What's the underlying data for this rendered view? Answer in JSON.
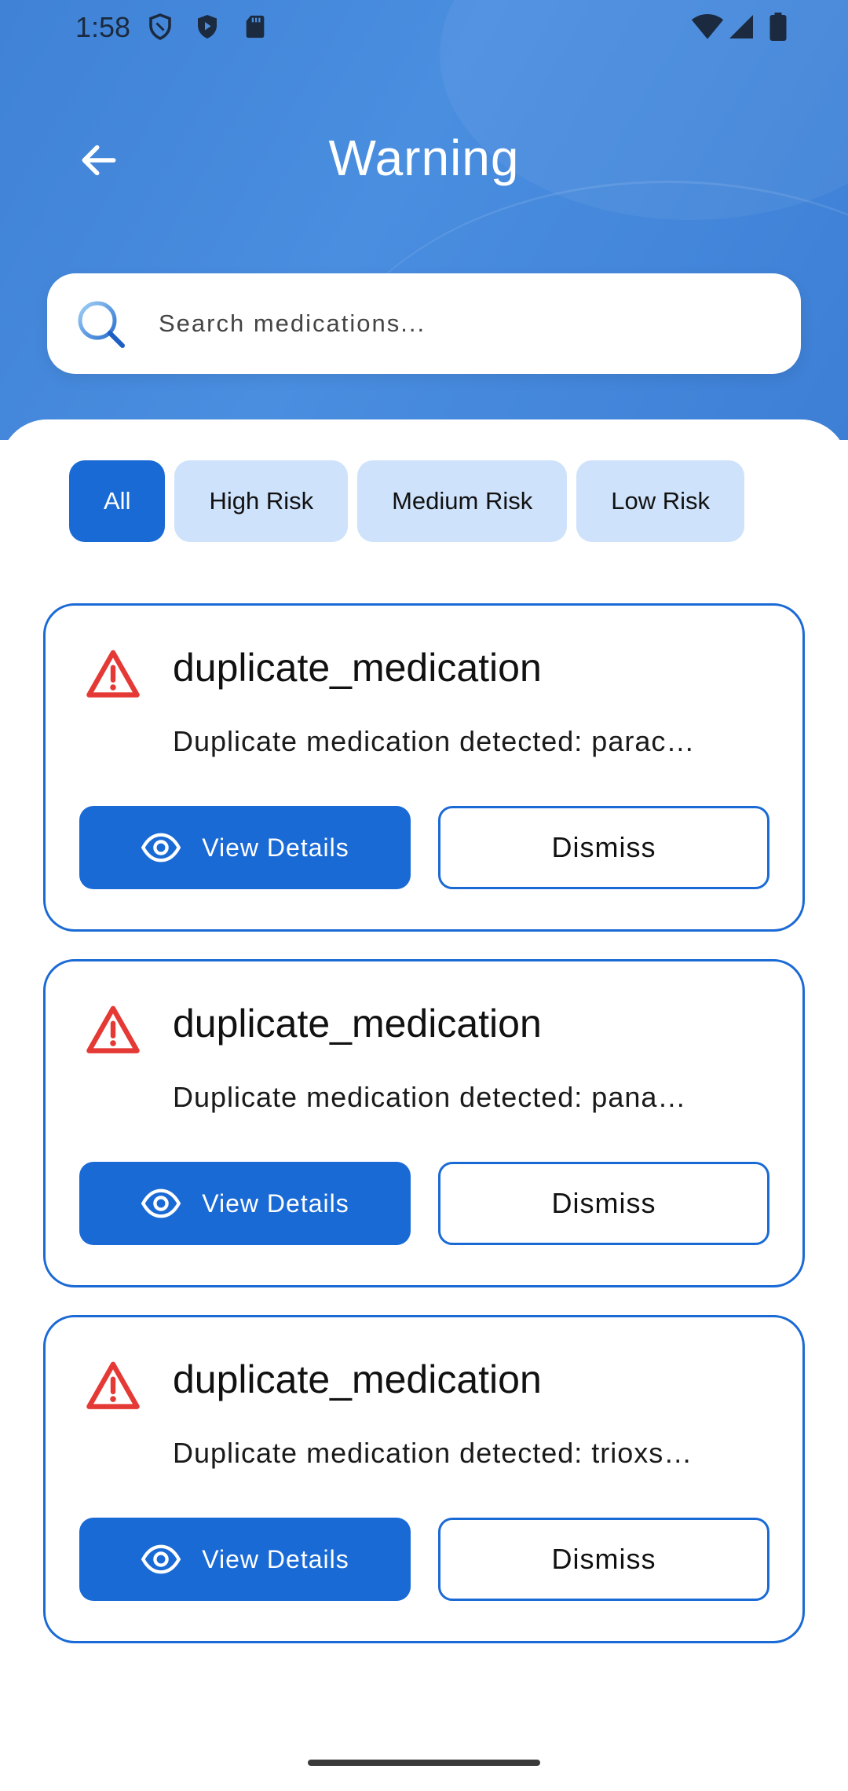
{
  "status_bar": {
    "time": "1:58",
    "left_icons": [
      "shield-icon",
      "play-shield-icon",
      "sd-card-icon"
    ],
    "right_icons": [
      "wifi-icon",
      "signal-icon",
      "battery-icon"
    ]
  },
  "header": {
    "title": "Warning",
    "back_icon": "arrow-left-icon"
  },
  "search": {
    "placeholder": "Search medications...",
    "value": ""
  },
  "filters": [
    {
      "label": "All",
      "active": true
    },
    {
      "label": "High Risk",
      "active": false
    },
    {
      "label": "Medium Risk",
      "active": false
    },
    {
      "label": "Low Risk",
      "active": false
    }
  ],
  "warnings": [
    {
      "title": "duplicate_medication",
      "description": "Duplicate medication detected: parac…",
      "view_label": "View Details",
      "dismiss_label": "Dismiss"
    },
    {
      "title": "duplicate_medication",
      "description": "Duplicate medication detected: pana…",
      "view_label": "View Details",
      "dismiss_label": "Dismiss"
    },
    {
      "title": "duplicate_medication",
      "description": "Duplicate medication detected: trioxs…",
      "view_label": "View Details",
      "dismiss_label": "Dismiss"
    }
  ],
  "colors": {
    "primary": "#1a6ad6",
    "chip_inactive": "#cfe2fb",
    "header_bg": "#4a8ee0",
    "warning_red": "#e53935"
  }
}
